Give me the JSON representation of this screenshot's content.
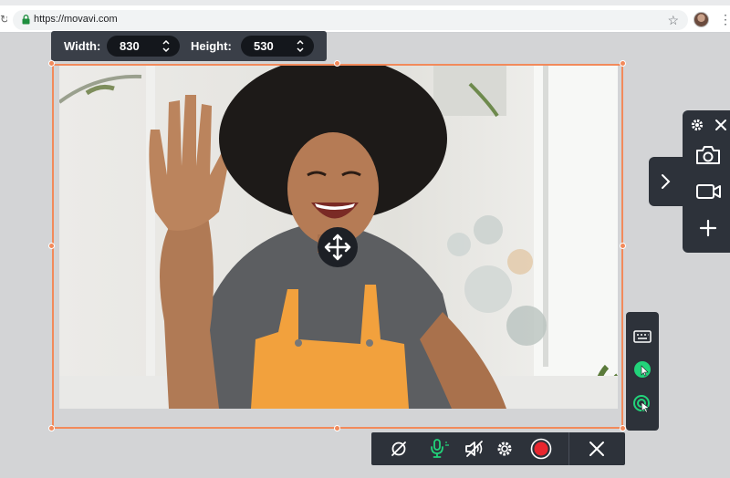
{
  "browser": {
    "url": "https://movavi.com",
    "icons": [
      "reload-icon",
      "lock-icon",
      "star-icon",
      "profile-avatar",
      "menu-dots-icon"
    ]
  },
  "capture": {
    "width_label": "Width:",
    "width_value": "830",
    "height_label": "Height:",
    "height_value": "530"
  },
  "side_panel": {
    "icons": [
      "gear-icon",
      "close-icon",
      "chevron-right-icon",
      "camera-icon",
      "video-camera-icon",
      "plus-icon"
    ]
  },
  "side_tools": {
    "icons": [
      "keyboard-icon",
      "cursor-highlight-icon",
      "click-effect-icon"
    ],
    "accent_color": "#22d37a"
  },
  "toolbar": {
    "icons": [
      "webcam-off-icon",
      "microphone-icon",
      "system-audio-off-icon",
      "settings-icon",
      "record-button",
      "close-icon"
    ],
    "record_color": "#e8262e",
    "mic_color": "#22d37a"
  },
  "colors": {
    "selection_border": "#f28a5b",
    "panel_bg": "#2d323a"
  }
}
